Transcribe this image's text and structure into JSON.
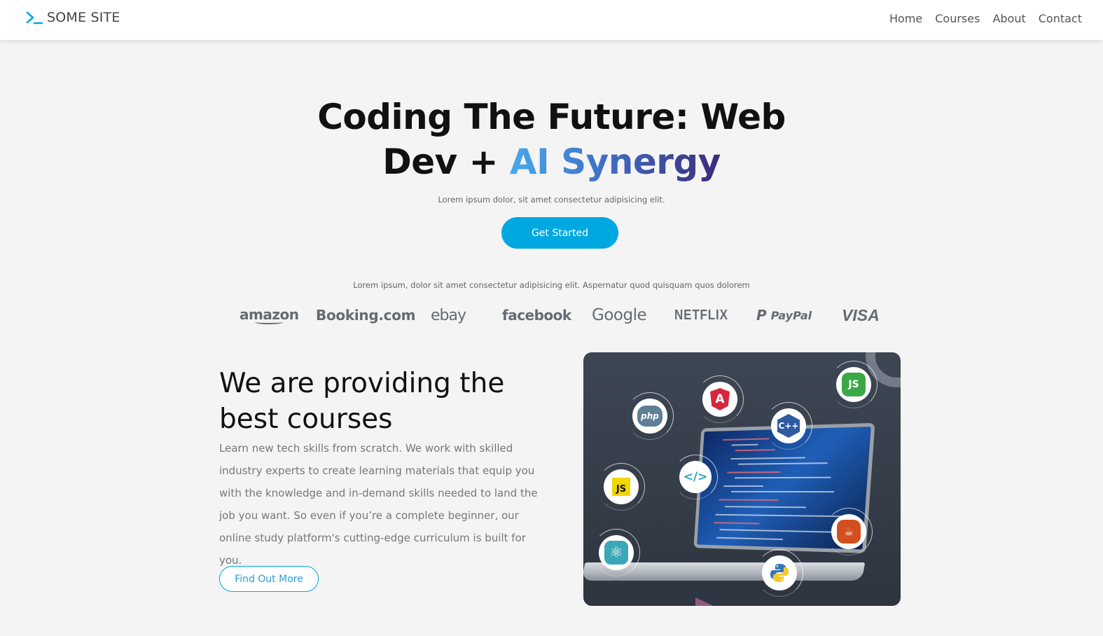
{
  "header": {
    "brand_icon": "terminal-prompt-icon",
    "brand_name": "SOME SITE",
    "nav": [
      {
        "label": "Home"
      },
      {
        "label": "Courses"
      },
      {
        "label": "About"
      },
      {
        "label": "Contact"
      }
    ]
  },
  "hero": {
    "title_line1": "Coding The Future: Web",
    "title_line2_plain": "Dev + ",
    "title_line2_highlight": "AI Synergy",
    "subtitle": "Lorem ipsum dolor, sit amet consectetur adipisicing elit.",
    "cta_label": "Get Started"
  },
  "partners": {
    "caption": "Lorem ipsum, dolor sit amet consectetur adipisicing elit. Aspernatur quod quisquam quos dolorem",
    "logos": [
      {
        "name": "amazon",
        "text": "amazon"
      },
      {
        "name": "booking",
        "text": "Booking.com"
      },
      {
        "name": "ebay",
        "text": "ebay"
      },
      {
        "name": "facebook",
        "text": "facebook"
      },
      {
        "name": "google",
        "text": "Google"
      },
      {
        "name": "netflix",
        "text": "NETFLIX"
      },
      {
        "name": "paypal",
        "text": "PayPal",
        "mark": "P"
      },
      {
        "name": "visa",
        "text": "VISA"
      }
    ]
  },
  "courses": {
    "title": "We are providing the best courses",
    "body": "Learn new tech skills from scratch. We work with skilled industry experts to create learning materials that equip you with the knowledge and in-demand skills needed to land the job you want. So even if you’re a complete beginner, our online study platform's cutting-edge curriculum is built for you.",
    "cta_label": "Find Out More",
    "illustration": {
      "description": "laptop with floating programming language badges",
      "badges": [
        {
          "name": "php",
          "text": "php"
        },
        {
          "name": "angular",
          "text": "A"
        },
        {
          "name": "nodejs",
          "text": "JS"
        },
        {
          "name": "cpp",
          "text": "C++"
        },
        {
          "name": "javascript",
          "text": "JS"
        },
        {
          "name": "code",
          "text": "</>"
        },
        {
          "name": "react",
          "text": "⚛"
        },
        {
          "name": "java",
          "text": "☕"
        },
        {
          "name": "python",
          "text": "🐍"
        }
      ]
    }
  },
  "colors": {
    "accent": "#00a8e1",
    "page_background": "#f4f4f4",
    "header_background": "#ffffff",
    "gradient_start": "#4aa8ec",
    "gradient_end": "#3b2a7a",
    "logo_gray": "#666b72"
  }
}
